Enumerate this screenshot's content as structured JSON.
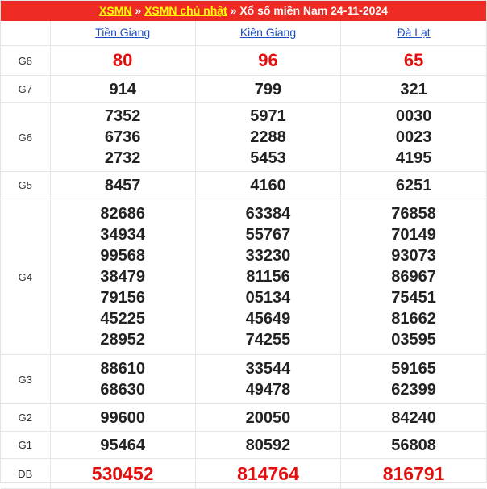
{
  "header": {
    "link1": "XSMN",
    "sep1": " » ",
    "link2": "XSMN chủ nhật",
    "sep2": " » ",
    "title": "Xổ số miền Nam 24-11-2024"
  },
  "provinces": [
    "Tiền Giang",
    "Kiên Giang",
    "Đà Lạt"
  ],
  "rows": [
    {
      "label": "G8",
      "values": [
        [
          "80"
        ],
        [
          "96"
        ],
        [
          "65"
        ]
      ]
    },
    {
      "label": "G7",
      "values": [
        [
          "914"
        ],
        [
          "799"
        ],
        [
          "321"
        ]
      ]
    },
    {
      "label": "G6",
      "values": [
        [
          "7352",
          "6736",
          "2732"
        ],
        [
          "5971",
          "2288",
          "5453"
        ],
        [
          "0030",
          "0023",
          "4195"
        ]
      ]
    },
    {
      "label": "G5",
      "values": [
        [
          "8457"
        ],
        [
          "4160"
        ],
        [
          "6251"
        ]
      ]
    },
    {
      "label": "G4",
      "values": [
        [
          "82686",
          "34934",
          "99568",
          "38479",
          "79156",
          "45225",
          "28952"
        ],
        [
          "63384",
          "55767",
          "33230",
          "81156",
          "05134",
          "45649",
          "74255"
        ],
        [
          "76858",
          "70149",
          "93073",
          "86967",
          "75451",
          "81662",
          "03595"
        ]
      ]
    },
    {
      "label": "G3",
      "values": [
        [
          "88610",
          "68630"
        ],
        [
          "33544",
          "49478"
        ],
        [
          "59165",
          "62399"
        ]
      ]
    },
    {
      "label": "G2",
      "values": [
        [
          "99600"
        ],
        [
          "20050"
        ],
        [
          "84240"
        ]
      ]
    },
    {
      "label": "G1",
      "values": [
        [
          "95464"
        ],
        [
          "80592"
        ],
        [
          "56808"
        ]
      ]
    },
    {
      "label": "ĐB",
      "values": [
        [
          "530452"
        ],
        [
          "814764"
        ],
        [
          "816791"
        ]
      ]
    }
  ],
  "colors": {
    "header_bg": "#ee2a24",
    "header_link": "#ffff00",
    "highlight_number": "#e30f0f",
    "province_link": "#1d4fc3"
  }
}
